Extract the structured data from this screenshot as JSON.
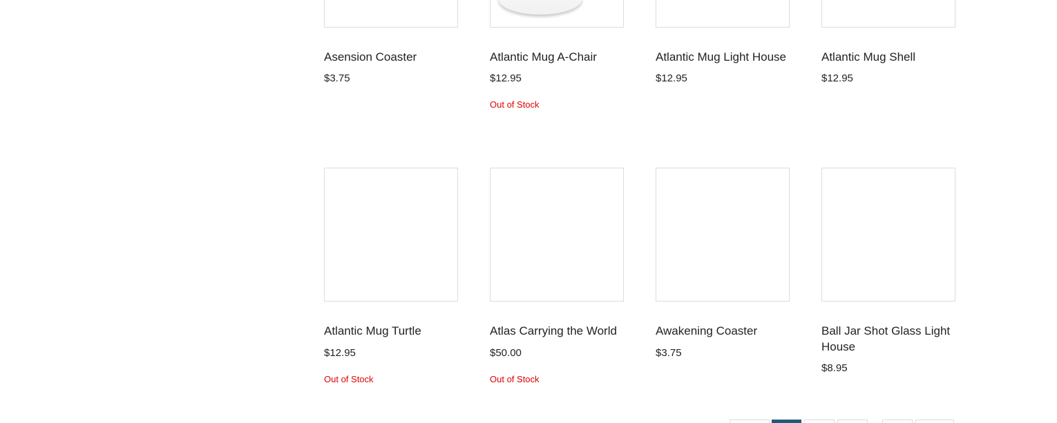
{
  "products": [
    {
      "name": "Asension Coaster",
      "price": "$3.75"
    },
    {
      "name": "Atlantic Mug A-Chair",
      "price": "$12.95",
      "stock": "Out of Stock"
    },
    {
      "name": "Atlantic Mug Light House",
      "price": "$12.95"
    },
    {
      "name": "Atlantic Mug Shell",
      "price": "$12.95"
    },
    {
      "name": "Atlantic Mug Turtle",
      "price": "$12.95",
      "stock": "Out of Stock"
    },
    {
      "name": "Atlas Carrying the World",
      "price": "$50.00",
      "stock": "Out of Stock"
    },
    {
      "name": "Awakening Coaster",
      "price": "$3.75"
    },
    {
      "name": "Ball Jar Shot Glass Light House",
      "price": "$8.95"
    }
  ],
  "colors": {
    "out_of_stock": "#e00000",
    "pagination_active": "#1f5a7a",
    "thumb_border": "#dcdcdc"
  }
}
